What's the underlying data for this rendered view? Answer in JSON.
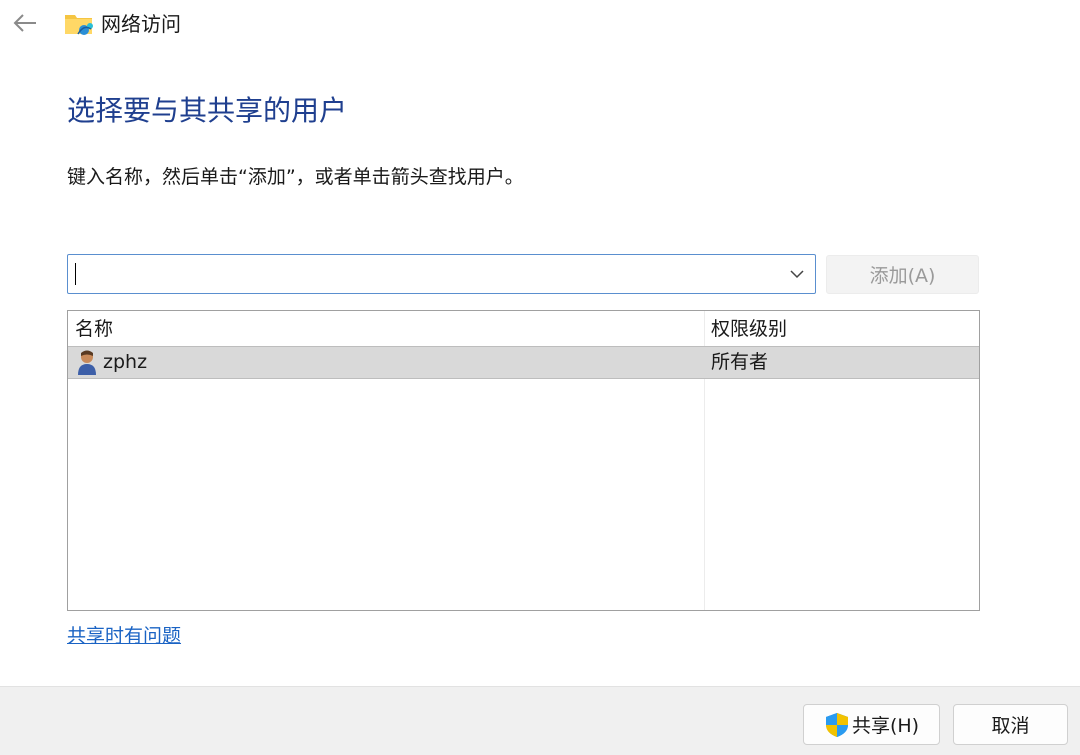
{
  "window": {
    "title": "网络访问"
  },
  "main": {
    "heading": "选择要与其共享的用户",
    "instruction": "键入名称，然后单击“添加”，或者单击箭头查找用户。",
    "name_input": {
      "value": "",
      "placeholder": ""
    },
    "add_label": "添加(A)"
  },
  "list": {
    "columns": [
      "名称",
      "权限级别"
    ],
    "rows": [
      {
        "name": "zphz",
        "permission": "所有者"
      }
    ]
  },
  "help_link": "共享时有问题",
  "footer": {
    "share_label": "共享(H)",
    "cancel_label": "取消"
  },
  "icons": {
    "back": "back-arrow-icon",
    "app": "network-folder-icon",
    "dropdown": "chevron-down-icon",
    "user": "user-icon",
    "shield": "uac-shield-icon"
  },
  "colors": {
    "heading": "#1f3f8f",
    "link": "#1a63c4",
    "selected_row": "#d9d9d9",
    "focus_border": "#5a8fcf"
  }
}
